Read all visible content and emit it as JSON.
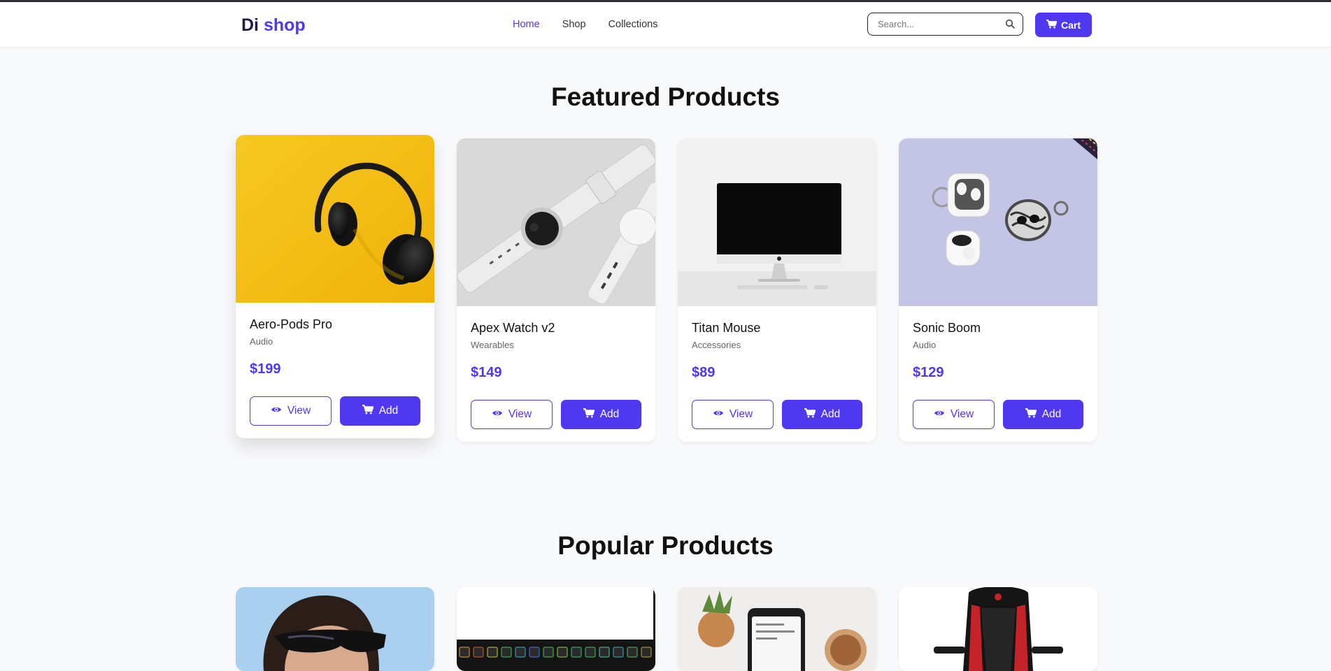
{
  "header": {
    "brand_part1": "Di",
    "brand_part2": "shop",
    "nav": [
      "Home",
      "Shop",
      "Collections"
    ],
    "active_nav": "Home",
    "search_placeholder": "Search...",
    "cart_label": "Cart"
  },
  "featured": {
    "title": "Featured Products",
    "products": [
      {
        "name": "Aero-Pods Pro",
        "category": "Audio",
        "price": "$199",
        "view_label": "View",
        "add_label": "Add"
      },
      {
        "name": "Apex Watch v2",
        "category": "Wearables",
        "price": "$149",
        "view_label": "View",
        "add_label": "Add"
      },
      {
        "name": "Titan Mouse",
        "category": "Accessories",
        "price": "$89",
        "view_label": "View",
        "add_label": "Add"
      },
      {
        "name": "Sonic Boom",
        "category": "Audio",
        "price": "$129",
        "view_label": "View",
        "add_label": "Add"
      }
    ]
  },
  "popular": {
    "title": "Popular Products"
  },
  "colors": {
    "accent": "#4f38f0",
    "brand_dark": "#1e1b4b",
    "page_bg": "#f8f9fb"
  }
}
